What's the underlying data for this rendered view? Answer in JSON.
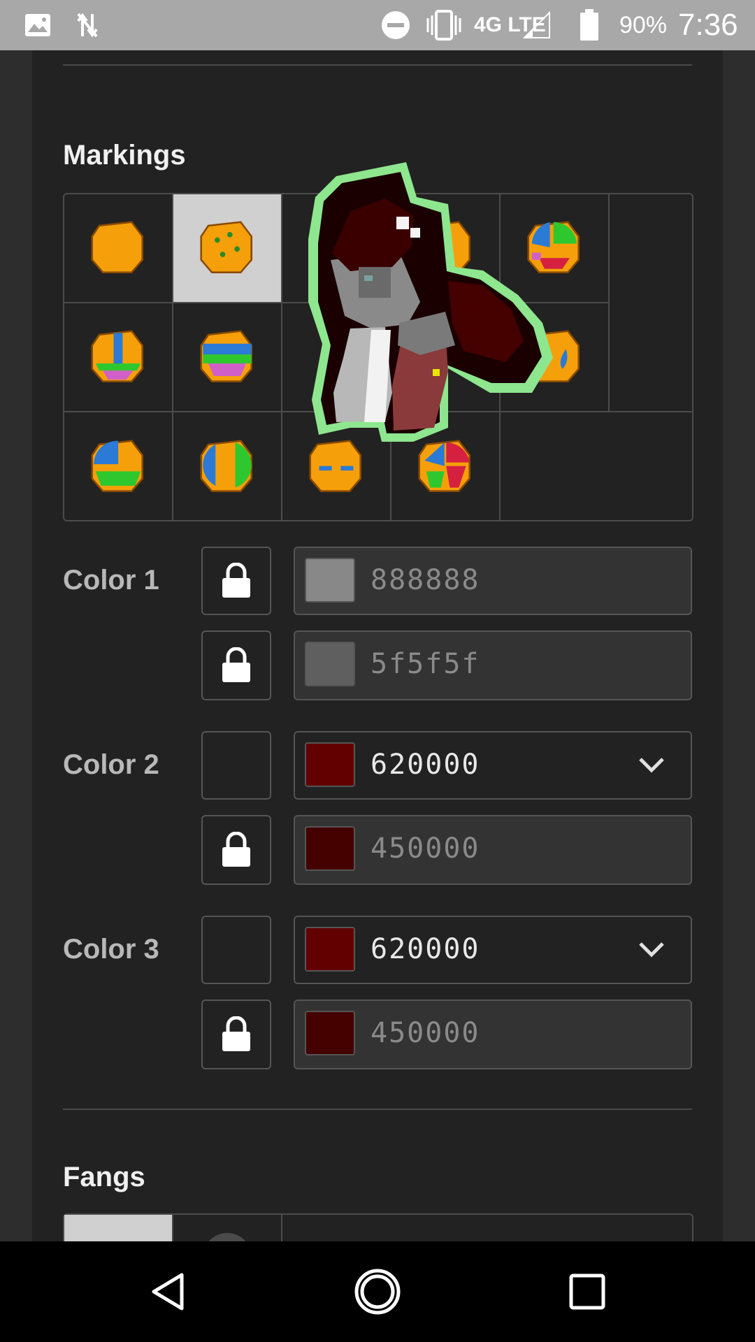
{
  "status_bar": {
    "network": "4G LTE",
    "battery": "90%",
    "time": "7:36"
  },
  "sections": {
    "markings_title": "Markings",
    "fangs_title": "Fangs"
  },
  "markings_grid": {
    "selected_index": 1,
    "items": [
      {
        "icon": "marking-none-icon"
      },
      {
        "icon": "marking-spots-icon"
      },
      {
        "icon": "marking-hidden-icon"
      },
      {
        "icon": "marking-stripe-icon"
      },
      {
        "icon": "marking-patches-icon"
      },
      {
        "icon": "marking-stripe-pink-green-icon"
      },
      {
        "icon": "marking-bands-icon"
      },
      {
        "icon": "marking-hidden-icon"
      },
      {
        "icon": "marking-hidden-icon"
      },
      {
        "icon": "marking-teardrop-icon"
      },
      {
        "icon": "marking-split-icon"
      },
      {
        "icon": "marking-vertical-split-icon"
      },
      {
        "icon": "marking-eyes-icon"
      },
      {
        "icon": "marking-multi-icon"
      }
    ]
  },
  "colors": [
    {
      "label": "Color 1",
      "rows": [
        {
          "locked": true,
          "hex": "888888",
          "swatch": "#888888",
          "editable": false
        },
        {
          "locked": true,
          "hex": "5f5f5f",
          "swatch": "#5f5f5f",
          "editable": false
        }
      ]
    },
    {
      "label": "Color 2",
      "rows": [
        {
          "locked": false,
          "hex": "620000",
          "swatch": "#620000",
          "editable": true
        },
        {
          "locked": true,
          "hex": "450000",
          "swatch": "#450000",
          "editable": false
        }
      ]
    },
    {
      "label": "Color 3",
      "rows": [
        {
          "locked": false,
          "hex": "620000",
          "swatch": "#620000",
          "editable": true
        },
        {
          "locked": true,
          "hex": "450000",
          "swatch": "#450000",
          "editable": false
        }
      ]
    }
  ],
  "theme": {
    "accent_outline": "#8ee68e",
    "marking_orange": "#f5a00a",
    "selected_cell": "#d0d0d0"
  }
}
